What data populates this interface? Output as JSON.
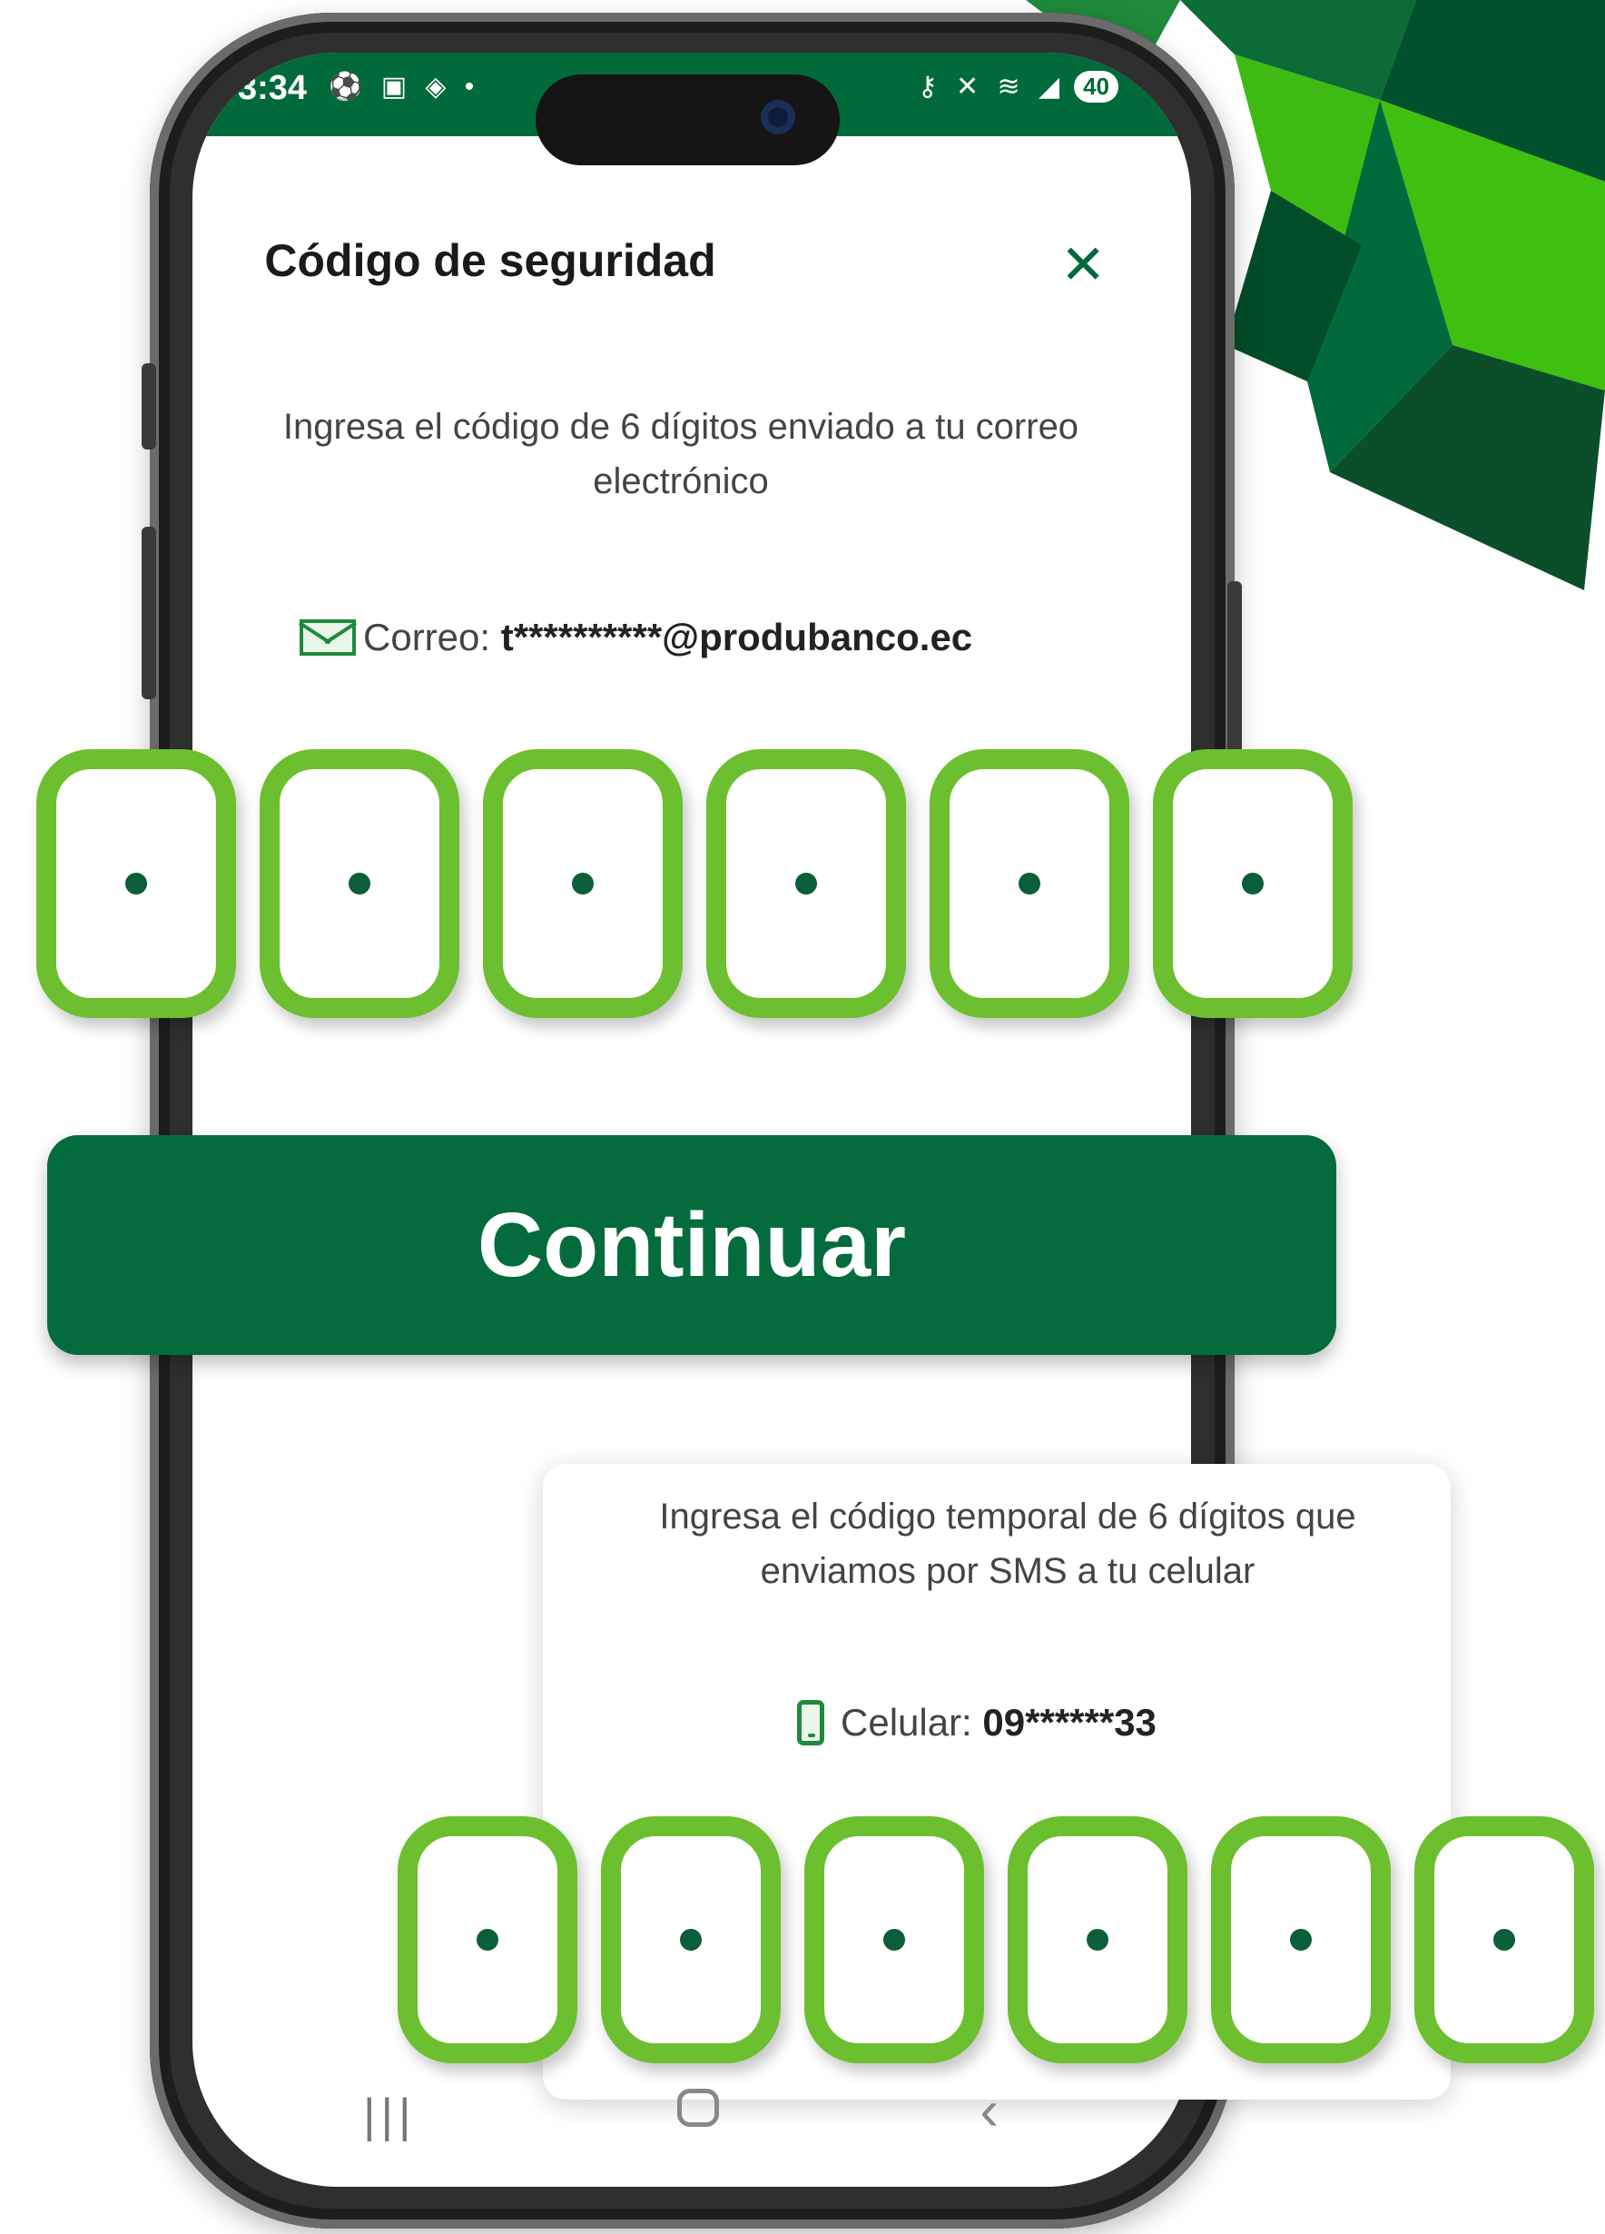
{
  "status_bar": {
    "time": "3:34",
    "left_icons": "⚽ ▣ ◈ •",
    "right_icons": "⚷ ✕ ≋ ◢",
    "battery": "40"
  },
  "dialog": {
    "title": "Código de seguridad",
    "close_icon": "close-icon",
    "email_instruction": "Ingresa el código de 6 dígitos enviado a  tu correo electrónico",
    "email_label": "Correo:",
    "email_value": "t**********@produbanco.ec"
  },
  "email_code": {
    "digits": [
      "•",
      "•",
      "•",
      "•",
      "•",
      "•"
    ],
    "length": 6
  },
  "continue_button": {
    "label": "Continuar"
  },
  "sms_card": {
    "instruction": "Ingresa el código temporal de 6 dígitos que enviamos por SMS a tu celular",
    "phone_label": "Celular:",
    "phone_value": "09******33"
  },
  "sms_code": {
    "digits": [
      "•",
      "•",
      "•",
      "•",
      "•",
      "•"
    ],
    "length": 6
  },
  "colors": {
    "brand_green": "#046b3d",
    "otp_border": "#6cbf2e",
    "status_bar": "#006a3a"
  },
  "navbar": {
    "recent_icon": "recent-apps-icon",
    "home_icon": "home-icon",
    "back_icon": "back-icon"
  }
}
